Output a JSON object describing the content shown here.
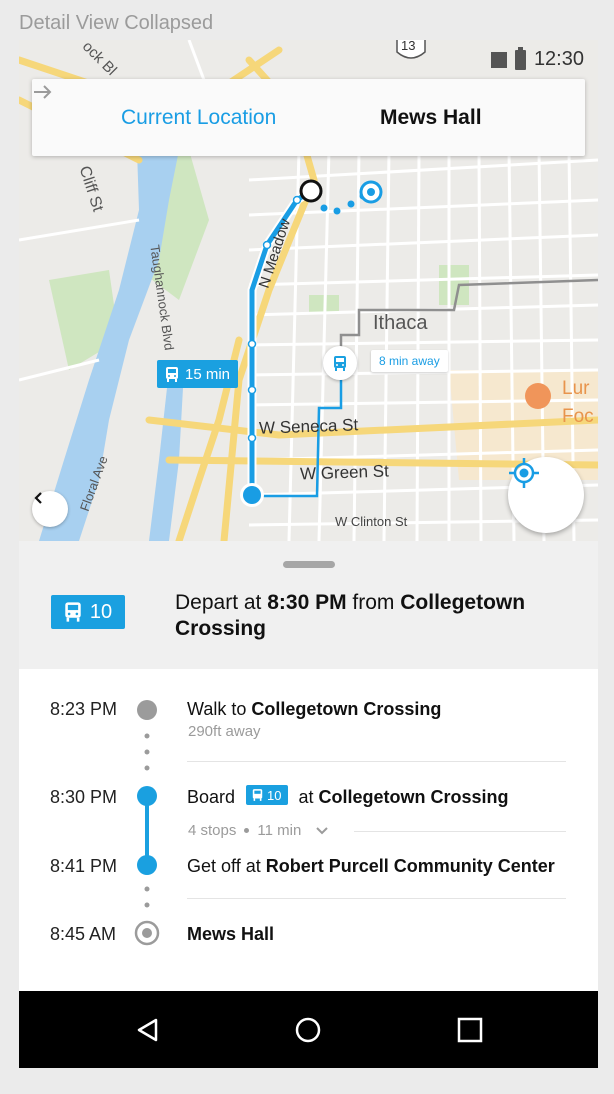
{
  "frame_title": "Detail View Collapsed",
  "status_bar": {
    "time": "12:30"
  },
  "route": {
    "from": "Current Location",
    "to": "Mews Hall"
  },
  "map": {
    "route_badge": "15 min",
    "bus_away": "8 min away",
    "labels": {
      "ithaca": "Ithaca",
      "w_seneca": "W Seneca St",
      "w_green": "W Green St",
      "w_clinton": "W Clinton St",
      "n_meadow": "N Meadow",
      "cliff": "Cliff St",
      "taughannock": "Taughannock Blvd",
      "floral": "Floral Ave",
      "bl": "ock Bl",
      "lur": "Lur",
      "foc": "Foc",
      "route_13": "13"
    }
  },
  "header": {
    "bus_number": "10",
    "depart_prefix": "Depart at ",
    "depart_time": "8:30 PM",
    "depart_mid": " from ",
    "depart_stop": "Collegetown Crossing"
  },
  "directions": [
    {
      "time": "8:23 PM",
      "prefix": "Walk to ",
      "place": "Collegetown Crossing",
      "sub": "290ft away"
    },
    {
      "time": "8:30 PM",
      "prefix": "Board ",
      "bus": "10",
      "mid": " at ",
      "place": "Collegetown Crossing",
      "stops": "4 stops",
      "duration": "11 min"
    },
    {
      "time": "8:41 PM",
      "prefix": "Get off at ",
      "place": "Robert Purcell Community Center"
    },
    {
      "time": "8:45 AM",
      "place": "Mews Hall"
    }
  ],
  "colors": {
    "accent": "#1aa0e0",
    "map_bg": "#ecebe8",
    "road_major": "#f6d77a",
    "water": "#a8d0f0"
  },
  "icons": [
    "bus-icon",
    "arrow-right-icon",
    "chevron-left-icon",
    "my-location-icon",
    "chevron-down-icon",
    "back-icon",
    "home-icon",
    "recents-icon"
  ]
}
